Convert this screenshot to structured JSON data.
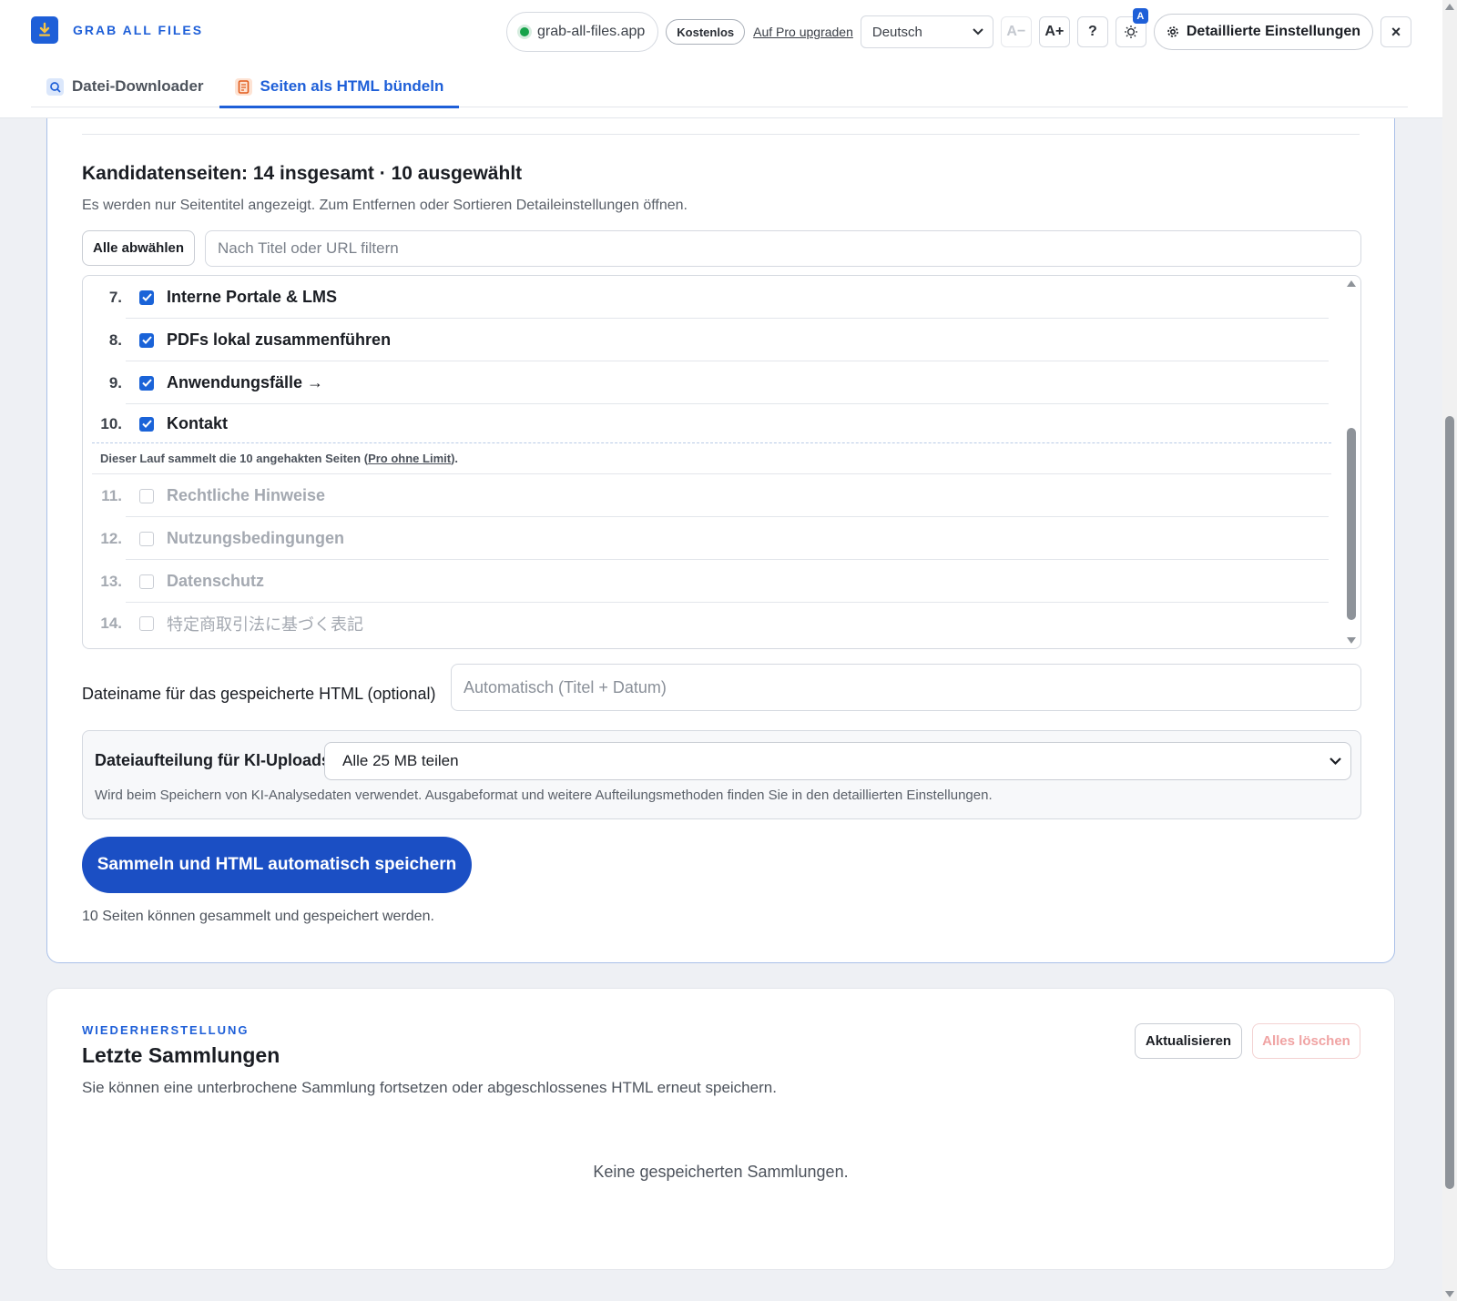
{
  "app": {
    "name": "GRAB ALL FILES",
    "site": "grab-all-files.app",
    "plan_badge": "Kostenlos",
    "upgrade_link": "Auf Pro upgraden",
    "language": "Deutsch",
    "font_decrease": "A−",
    "font_increase": "A+",
    "help": "?",
    "auto_badge": "A",
    "detail_settings": "Detaillierte Einstellungen",
    "close": "×"
  },
  "tabs": [
    {
      "label": "Datei-Downloader",
      "active": false
    },
    {
      "label": "Seiten als HTML bündeln",
      "active": true
    }
  ],
  "candidates": {
    "title": "Kandidatenseiten: 14 insgesamt · 10 ausgewählt",
    "subtitle": "Es werden nur Seitentitel angezeigt. Zum Entfernen oder Sortieren Detaileinstellungen öffnen.",
    "deselect_all": "Alle abwählen",
    "filter_placeholder": "Nach Titel oder URL filtern",
    "rows": [
      {
        "num": "7.",
        "title": "Interne Portale & LMS",
        "checked": true
      },
      {
        "num": "8.",
        "title": "PDFs lokal zusammenführen",
        "checked": true
      },
      {
        "num": "9.",
        "title": "Anwendungsfälle →",
        "checked": true
      },
      {
        "num": "10.",
        "title": "Kontakt",
        "checked": true
      },
      {
        "num": "11.",
        "title": "Rechtliche Hinweise",
        "checked": false
      },
      {
        "num": "12.",
        "title": "Nutzungsbedingungen",
        "checked": false
      },
      {
        "num": "13.",
        "title": "Datenschutz",
        "checked": false
      },
      {
        "num": "14.",
        "title": "特定商取引法に基づく表記",
        "checked": false
      }
    ],
    "limit_note_prefix": "Dieser Lauf sammelt die 10 angehakten Seiten (",
    "limit_note_link": "Pro ohne Limit",
    "limit_note_suffix": ")."
  },
  "filename": {
    "label": "Dateiname für das gespeicherte HTML (optional)",
    "placeholder": "Automatisch (Titel + Datum)"
  },
  "split": {
    "label": "Dateiaufteilung für KI-Uploads",
    "selected": "Alle 25 MB teilen",
    "hint": "Wird beim Speichern von KI-Analysedaten verwendet. Ausgabeformat und weitere Aufteilungsmethoden finden Sie in den detaillierten Einstellungen."
  },
  "primary_action": "Sammeln und HTML automatisch speichern",
  "status": "10 Seiten können gesammelt und gespeichert werden.",
  "recovery": {
    "eyebrow": "WIEDERHERSTELLUNG",
    "title": "Letzte Sammlungen",
    "subtitle": "Sie können eine unterbrochene Sammlung fortsetzen oder abgeschlossenes HTML erneut speichern.",
    "refresh": "Aktualisieren",
    "clear_all": "Alles löschen",
    "empty": "Keine gespeicherten Sammlungen."
  },
  "colors": {
    "accent": "#1e5fd8",
    "primary_button": "#1b4fc4",
    "checkbox": "#1a63d8",
    "danger_disabled": "#f0a3a3"
  }
}
